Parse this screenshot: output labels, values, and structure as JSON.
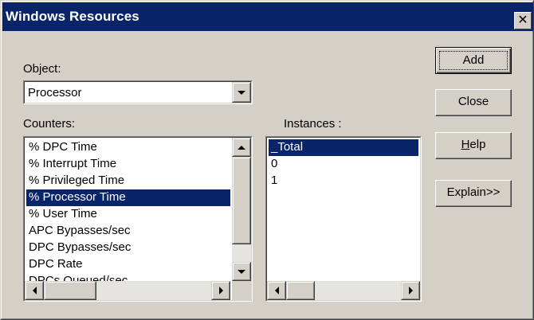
{
  "window": {
    "title": "Windows Resources",
    "close_glyph": "✕"
  },
  "object": {
    "label": "Object:",
    "selected": "Processor"
  },
  "counters": {
    "label": "Counters:",
    "items": [
      "% DPC Time",
      "% Interrupt Time",
      "% Privileged Time",
      "% Processor Time",
      "% User Time",
      "APC Bypasses/sec",
      "DPC Bypasses/sec",
      "DPC Rate",
      "DPCs Queued/sec"
    ],
    "selected_index": 3
  },
  "instances": {
    "label": "Instances :",
    "items": [
      "_Total",
      "0",
      "1"
    ],
    "selected_index": 0
  },
  "buttons": {
    "add": "Add",
    "close": "Close",
    "help_mnemonic": "H",
    "help_rest": "elp",
    "explain": "Explain>>"
  },
  "colors": {
    "selection": "#0a246a",
    "face": "#d4d0c8",
    "title_bar": "#0a246a"
  }
}
